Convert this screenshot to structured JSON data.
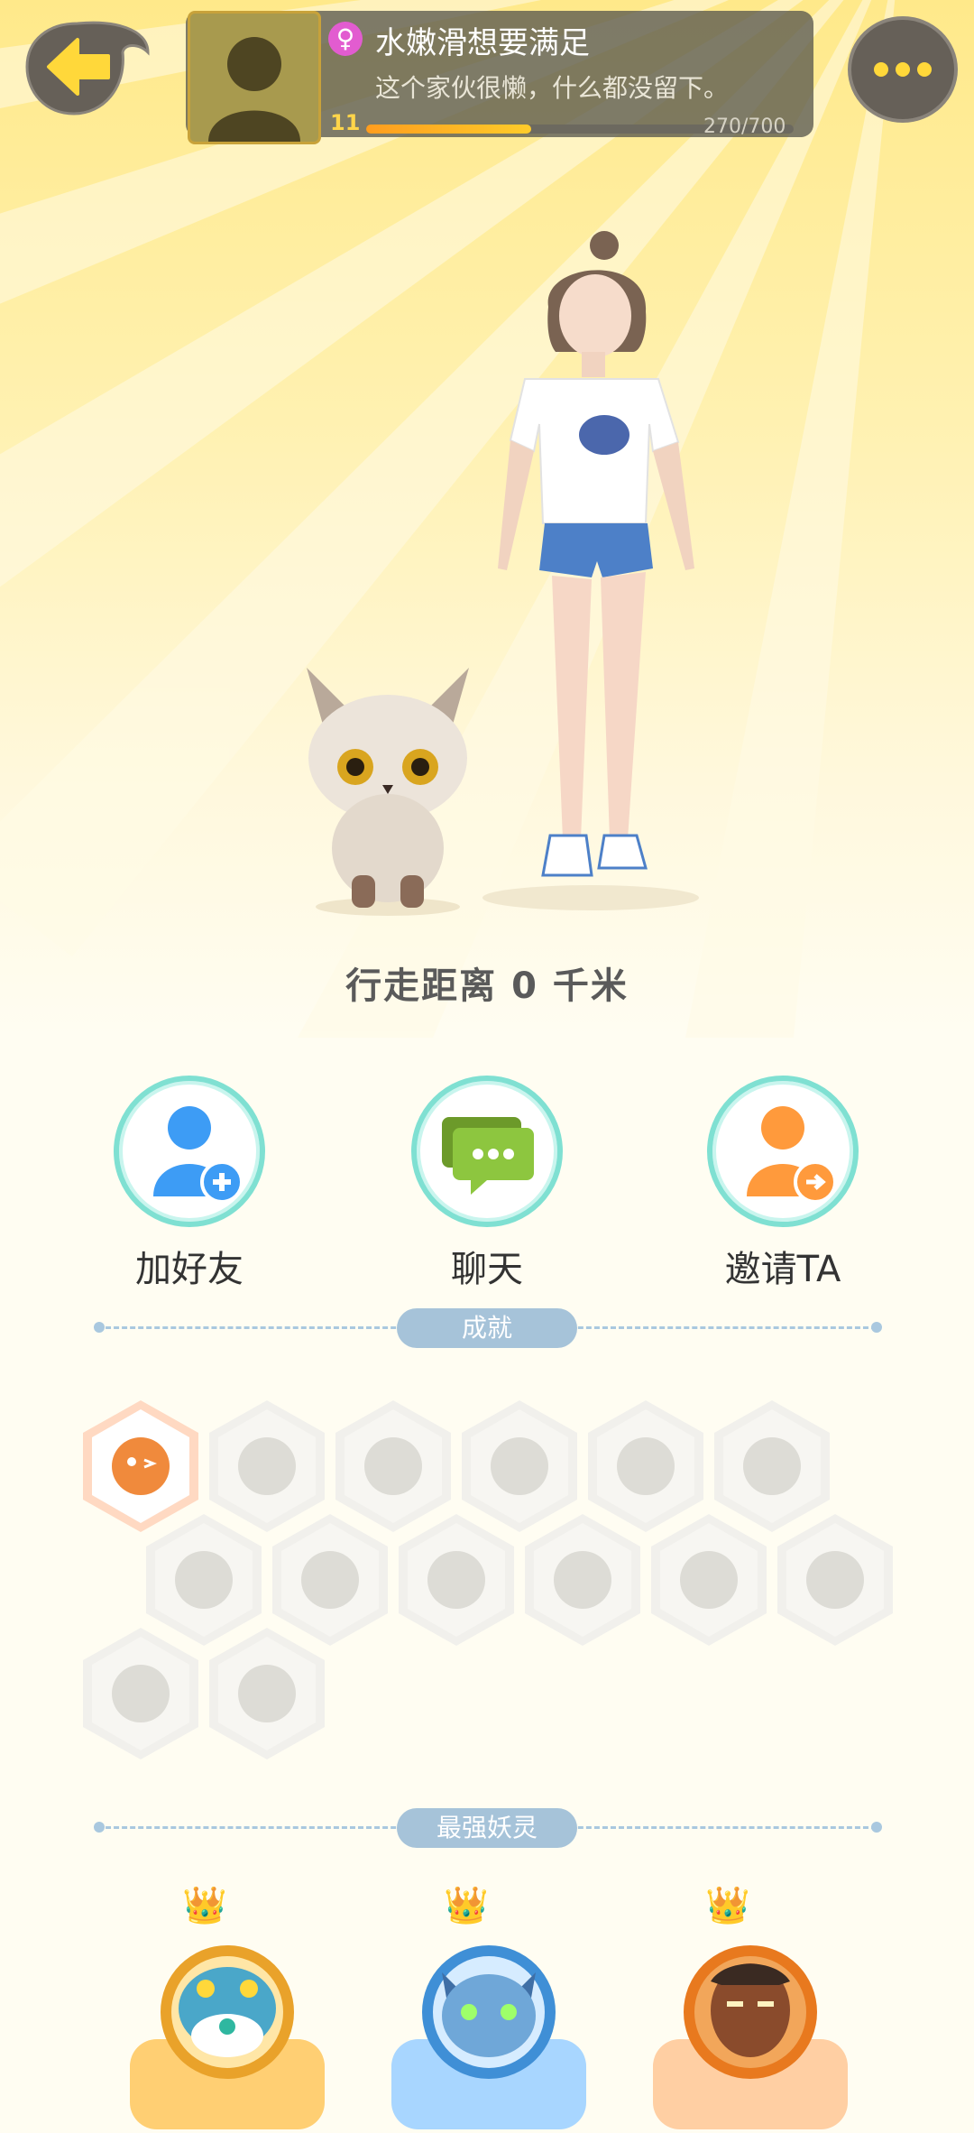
{
  "header": {
    "nickname": "水嫩滑想要满足",
    "signature": "这个家伙很懒，什么都没留下。",
    "gender_symbol": "♀",
    "level": "11",
    "exp_text": "270/700",
    "exp_progress": 0.386
  },
  "walk_distance": "行走距离 0 千米",
  "actions": [
    {
      "label": "加好友"
    },
    {
      "label": "聊天"
    },
    {
      "label": "邀请TA"
    }
  ],
  "sections": {
    "achievements": "成就",
    "strongest_spirits": "最强妖灵"
  },
  "achievement_badges": [
    {
      "name": "fox-face-icon",
      "unlocked": true
    },
    {
      "name": "sneaker-icon",
      "unlocked": false
    },
    {
      "name": "target-icon",
      "unlocked": false
    },
    {
      "name": "moon-icon",
      "unlocked": false
    },
    {
      "name": "pokeball-icon",
      "unlocked": false
    },
    {
      "name": "crystal-icon",
      "unlocked": false
    },
    {
      "name": "yin-yang-swirl-icon",
      "unlocked": false
    },
    {
      "name": "spirit-flame-icon",
      "unlocked": false
    },
    {
      "name": "cat-cart-icon",
      "unlocked": false
    },
    {
      "name": "cat-balloon-icon",
      "unlocked": false
    },
    {
      "name": "taiji-icon",
      "unlocked": false
    },
    {
      "name": "dragon-icon",
      "unlocked": false
    },
    {
      "name": "shield-icon",
      "unlocked": false
    },
    {
      "name": "book-icon",
      "unlocked": false
    }
  ],
  "colors": {
    "accent_yellow": "#ffd83a",
    "action_ring": "#7fe0d2",
    "friend_blue": "#3d9cf5",
    "chat_green": "#8dc63f",
    "invite_orange": "#ff9a3c",
    "section_tag": "#a6c3d9"
  }
}
